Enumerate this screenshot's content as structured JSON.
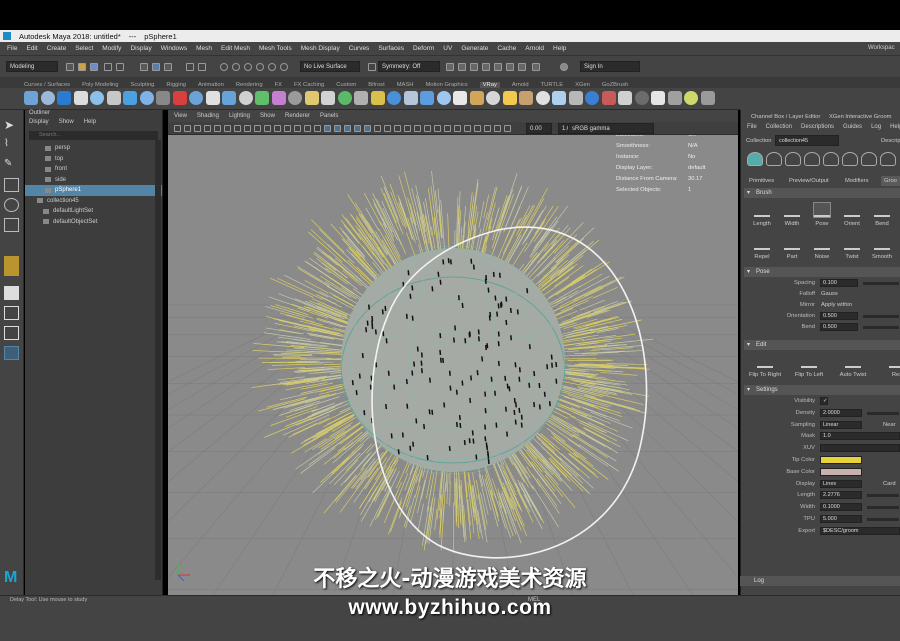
{
  "window": {
    "title": "Autodesk Maya 2018: untitled*",
    "separator": "---",
    "object": "pSphere1"
  },
  "menubar": [
    "File",
    "Edit",
    "Create",
    "Select",
    "Modify",
    "Display",
    "Windows",
    "Mesh",
    "Edit Mesh",
    "Mesh Tools",
    "Mesh Display",
    "Curves",
    "Surfaces",
    "Deform",
    "UV",
    "Generate",
    "Cache",
    "Arnold",
    "Help"
  ],
  "workspace_label": "Workspac",
  "statusline": {
    "menuset": "Modeling",
    "live_surface": "No Live Surface",
    "symmetry": "Symmetry: Off",
    "sign_in": "Sign In"
  },
  "shelf_tabs": [
    "Curves / Surfaces",
    "Poly Modeling",
    "Sculpting",
    "Rigging",
    "Animation",
    "Rendering",
    "FX",
    "FX Caching",
    "Custom",
    "Bifrost",
    "MASH",
    "Motion Graphics",
    "VRay",
    "Arnold",
    "TURTLE",
    "XGen",
    "GoZBrush"
  ],
  "shelf_active": "VRay",
  "colors": {
    "shelf_icons": [
      "#6fa3d6",
      "#9bb8d9",
      "#2b7bd0",
      "#dcdcdc",
      "#8cc0ea",
      "#c7c7c7",
      "#4aa0e0",
      "#7fb2e6",
      "#888",
      "#d93f3f",
      "#6ba2d8",
      "#e0e0e0",
      "#66a3d8",
      "#d0d0d0",
      "#5fbf6a",
      "#c57fd1",
      "#9a9a9a",
      "#e0c870",
      "#d2d2d2",
      "#5bb96a",
      "#b0b0b0",
      "#d8c04a",
      "#4a8fd9",
      "#b6c6da",
      "#5c9de0",
      "#9ec6f0",
      "#e8e8e8",
      "#d2a65a",
      "#d6d6d6",
      "#f2c94c",
      "#c8a070",
      "#e0e0e0",
      "#aed0ee",
      "#b7b7b7",
      "#3c7fd0",
      "#c85a5a",
      "#d0d0d0",
      "#6c6c6c",
      "#e6e6e6",
      "#a0a0a0",
      "#cfd86b",
      "#9a9a9a"
    ],
    "tip_color": "#e8d23a",
    "base_color": "#c8b2ae",
    "selection": "#5285a6"
  },
  "outliner": {
    "title": "Outliner",
    "menu": [
      "Display",
      "Show",
      "Help"
    ],
    "search_placeholder": "Search...",
    "items": [
      {
        "label": "persp",
        "selected": false
      },
      {
        "label": "top",
        "selected": false
      },
      {
        "label": "front",
        "selected": false
      },
      {
        "label": "side",
        "selected": false
      },
      {
        "label": "pSphere1",
        "selected": true
      },
      {
        "label": "collection45",
        "selected": false
      },
      {
        "label": "defaultLightSet",
        "selected": false
      },
      {
        "label": "defaultObjectSet",
        "selected": false
      }
    ]
  },
  "viewport": {
    "menu": [
      "View",
      "Shading",
      "Lighting",
      "Show",
      "Renderer",
      "Panels"
    ],
    "gamma": "sRGB gamma",
    "exposure": "0.00",
    "gamma_value": "1.00",
    "hud": [
      {
        "label": "Backfaces:",
        "value": "On"
      },
      {
        "label": "Smoothness:",
        "value": "N/A"
      },
      {
        "label": "Instance:",
        "value": "No"
      },
      {
        "label": "Display Layer:",
        "value": "default"
      },
      {
        "label": "Distance From Camera:",
        "value": "30.17"
      },
      {
        "label": "Selected Objects:",
        "value": "1"
      }
    ]
  },
  "rightpanel": {
    "tab1": "Channel Box / Layer Editor",
    "tab2": "XGen Interactive Groom",
    "menu": [
      "File",
      "Collection",
      "Descriptions",
      "Guides",
      "Log",
      "Help"
    ],
    "collection_label": "Collection",
    "collection_value": "collection45",
    "description_label": "Descrip",
    "subtabs": [
      "Preview/Output",
      "Modifiers",
      "Groo"
    ],
    "first_subtab": "Primitives",
    "brush_section": "Brush",
    "brush_buttons_row1": [
      "Length",
      "Width",
      "Pose",
      "Orient",
      "Bend"
    ],
    "brush_buttons_row2": [
      "Repel",
      "Part",
      "Noise",
      "Twist",
      "Smooth"
    ],
    "pose_section": "Pose",
    "pose_params": [
      {
        "label": "Spacing",
        "value": "0.100"
      },
      {
        "label": "Falloff",
        "value": "Gauss"
      },
      {
        "label": "Mirror",
        "value": "Apply within"
      },
      {
        "label": "Orientation",
        "value": "0.500"
      },
      {
        "label": "Bend",
        "value": "0.500"
      }
    ],
    "edit_section": "Edit",
    "edit_buttons": [
      "Flip To Right",
      "Flip To Left",
      "Auto Twist",
      "Res"
    ],
    "settings_section": "Settings",
    "settings_params": [
      {
        "label": "Visibility",
        "value": "✓"
      },
      {
        "label": "Density",
        "value": "2.0000"
      },
      {
        "label": "Sampling",
        "value": "Linear"
      },
      {
        "label": "Mask",
        "value": "1.0"
      },
      {
        "label": "XUV",
        "value": ""
      },
      {
        "label": "Tip Color",
        "value": ""
      },
      {
        "label": "Base Color",
        "value": ""
      },
      {
        "label": "Display",
        "value": "Lines"
      },
      {
        "label": "Length",
        "value": "2.2776"
      },
      {
        "label": "Width",
        "value": "0.1000"
      },
      {
        "label": "TPU",
        "value": "5.000"
      },
      {
        "label": "Export",
        "value": "$DESC/groom"
      }
    ],
    "sampling_other": "Near",
    "display_other": "Card",
    "log_section": "Log"
  },
  "help_line": "Delay Tool: Use mouse to study",
  "mel_label": "MEL",
  "watermark": {
    "line1": "不移之火-动漫游戏美术资源",
    "line2": "www.byzhihuo.com"
  }
}
